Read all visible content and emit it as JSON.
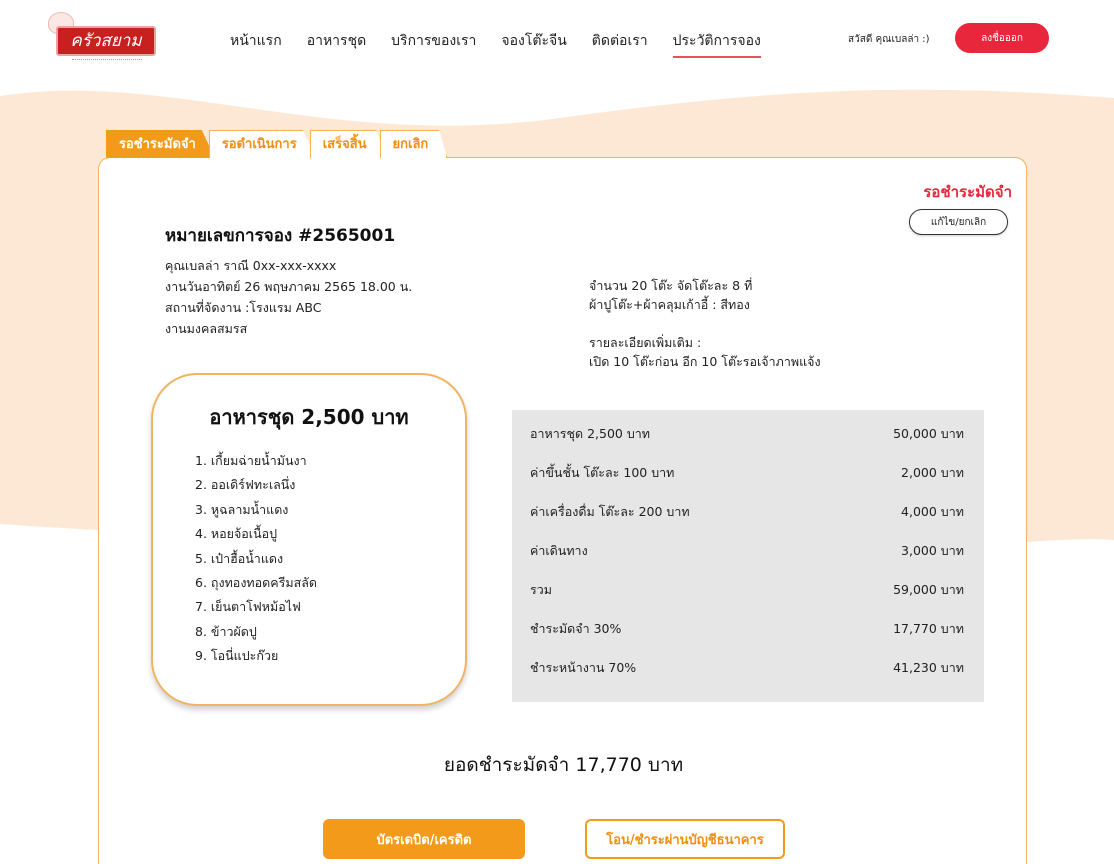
{
  "brand": {
    "logo_text": "ครัวสยาม"
  },
  "nav": {
    "items": [
      {
        "label": "หน้าแรก"
      },
      {
        "label": "อาหารชุด"
      },
      {
        "label": "บริการของเรา"
      },
      {
        "label": "จองโต๊ะจีน"
      },
      {
        "label": "ติดต่อเรา"
      },
      {
        "label": "ประวัติการจอง"
      }
    ],
    "active": "ประวัติการจอง",
    "greeting": "สวัสดี คุณเบลล่า :)",
    "logout_label": "ลงชื่อออก"
  },
  "tabs": [
    {
      "label": "รอชำระมัดจำ",
      "active": true
    },
    {
      "label": "รอดำเนินการ",
      "active": false
    },
    {
      "label": "เสร็จสิ้น",
      "active": false
    },
    {
      "label": "ยกเลิก",
      "active": false
    }
  ],
  "booking": {
    "status": "รอชำระมัดจำ",
    "edit_label": "แก้ไข/ยกเลิก",
    "number": "หมายเลขการจอง #2565001",
    "customer": "คุณเบลล่า ราณี 0xx-xxx-xxxx",
    "date": "งานวันอาทิตย์ 26 พฤษภาคม 2565 18.00 น.",
    "venue": "สถานที่จัดงาน :โรงแรม ABC",
    "event": "งานมงคลสมรส",
    "tables": "จำนวน 20 โต๊ะ จัดโต๊ะละ 8 ที่",
    "cloth": "ผ้าปูโต๊ะ+ผ้าคลุมเก้าอี้ : สีทอง",
    "more_label": "รายละเอียดเพิ่มเติม :",
    "more_text": "เปิด 10 โต๊ะก่อน อีก 10 โต๊ะรอเจ้าภาพแจ้ง"
  },
  "set_menu": {
    "title": "อาหารชุด 2,500 บาท",
    "items": [
      "1. เกี้ยมฉ่ายน้ำมันงา",
      "2. ออเดิร์ฟทะเลนึ่ง",
      "3. หูฉลามน้ำแดง",
      "4. หอยจ้อเนื้อปู",
      "5. เป๋าฮื้อน้ำแดง",
      "6. ถุงทองทอดครีมสลัด",
      "7. เย็นตาโฟหม้อไฟ",
      "8. ข้าวผัดปู",
      "9. โอนี่แปะก๊วย"
    ]
  },
  "price_table": [
    {
      "label": "อาหารชุด 2,500 บาท",
      "value": "50,000 บาท"
    },
    {
      "label": "ค่าขึ้นชั้น โต๊ะละ 100 บาท",
      "value": "2,000 บาท"
    },
    {
      "label": "ค่าเครื่องดื่ม โต๊ะละ 200 บาท",
      "value": "4,000 บาท"
    },
    {
      "label": "ค่าเดินทาง",
      "value": "3,000 บาท"
    },
    {
      "label": "รวม",
      "value": "59,000 บาท"
    },
    {
      "label": "ชำระมัดจำ 30%",
      "value": "17,770 บาท"
    },
    {
      "label": "ชำระหน้างาน 70%",
      "value": "41,230 บาท"
    }
  ],
  "deposit_total": "ยอดชำระมัดจำ 17,770 บาท",
  "payment": {
    "card_label": "บัตรเดบิต/เครดิต",
    "bank_label": "โอน/ชำระผ่านบัญชีธนาคาร"
  },
  "colors": {
    "accent": "#f39a1a",
    "danger": "#e8263c",
    "wave": "#fde8d5"
  }
}
